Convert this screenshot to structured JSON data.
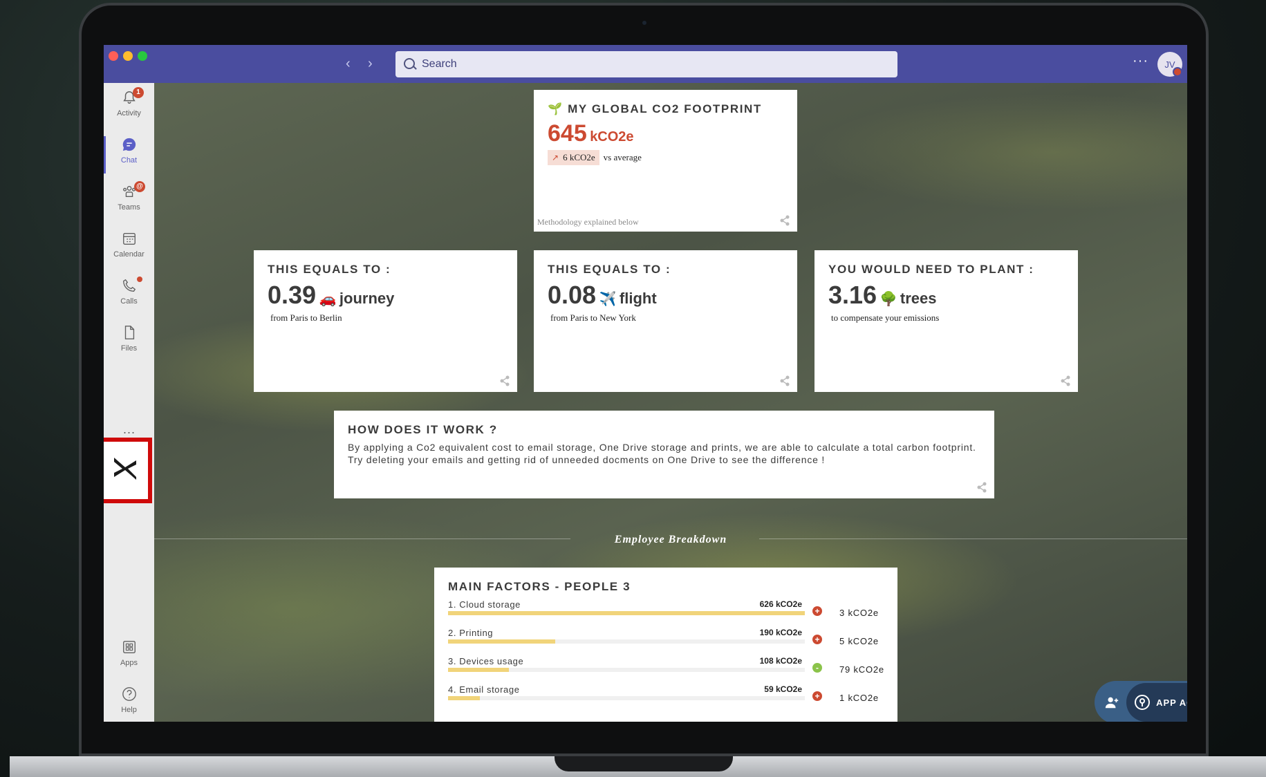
{
  "titlebar": {
    "search_placeholder": "Search",
    "avatar_initials": "JV",
    "more": "···"
  },
  "rail": {
    "items": [
      {
        "label": "Activity",
        "badge": "1"
      },
      {
        "label": "Chat"
      },
      {
        "label": "Teams",
        "badge": "@"
      },
      {
        "label": "Calendar"
      },
      {
        "label": "Calls"
      },
      {
        "label": "Files"
      },
      {
        "label": "Apps"
      },
      {
        "label": "Help"
      }
    ],
    "more": "···"
  },
  "footprint": {
    "title": "MY GLOBAL CO2 FOOTPRINT",
    "value": "645",
    "unit": "kCO2e",
    "delta": "6 kCO2e",
    "delta_label": "vs average",
    "methodology": "Methodology explained below"
  },
  "equivalents": [
    {
      "title": "THIS EQUALS TO :",
      "value": "0.39",
      "emoji": "🚗",
      "unit": "journey",
      "sub": "from Paris to Berlin"
    },
    {
      "title": "THIS EQUALS TO :",
      "value": "0.08",
      "emoji": "✈️",
      "unit": "flight",
      "sub": "from Paris to New York"
    },
    {
      "title": "YOU WOULD NEED TO PLANT :",
      "value": "3.16",
      "emoji": "🌳",
      "unit": "trees",
      "sub": "to compensate your emissions"
    }
  ],
  "how": {
    "title": "HOW DOES IT WORK ?",
    "line1": "By applying a Co2 equivalent cost to email storage, One Drive storage and prints, we are able to calculate a total carbon footprint.",
    "line2": "Try deleting your emails and getting rid of unneeded docments on One Drive to see the difference !"
  },
  "breakdown": {
    "heading": "Employee Breakdown",
    "title": "MAIN FACTORS - PEOPLE 3",
    "factors": [
      {
        "name": "1. Cloud storage",
        "value": "626 kCO2e",
        "fraction": 1.0,
        "sign": "+",
        "delta": "3 kCO2e"
      },
      {
        "name": "2. Printing",
        "value": "190 kCO2e",
        "fraction": 0.3,
        "sign": "+",
        "delta": "5 kCO2e"
      },
      {
        "name": "3. Devices usage",
        "value": "108 kCO2e",
        "fraction": 0.17,
        "sign": "-",
        "delta": "79 kCO2e"
      },
      {
        "name": "4. Email storage",
        "value": "59 kCO2e",
        "fraction": 0.09,
        "sign": "+",
        "delta": "1 kCO2e"
      }
    ]
  },
  "app_access": {
    "label": "APP ACCESS"
  },
  "colors": {
    "accent_red": "#cc4a31",
    "positive_green": "#8bc34a",
    "bar_yellow": "#f1d47a",
    "teams_purple": "#4a4d9f"
  }
}
